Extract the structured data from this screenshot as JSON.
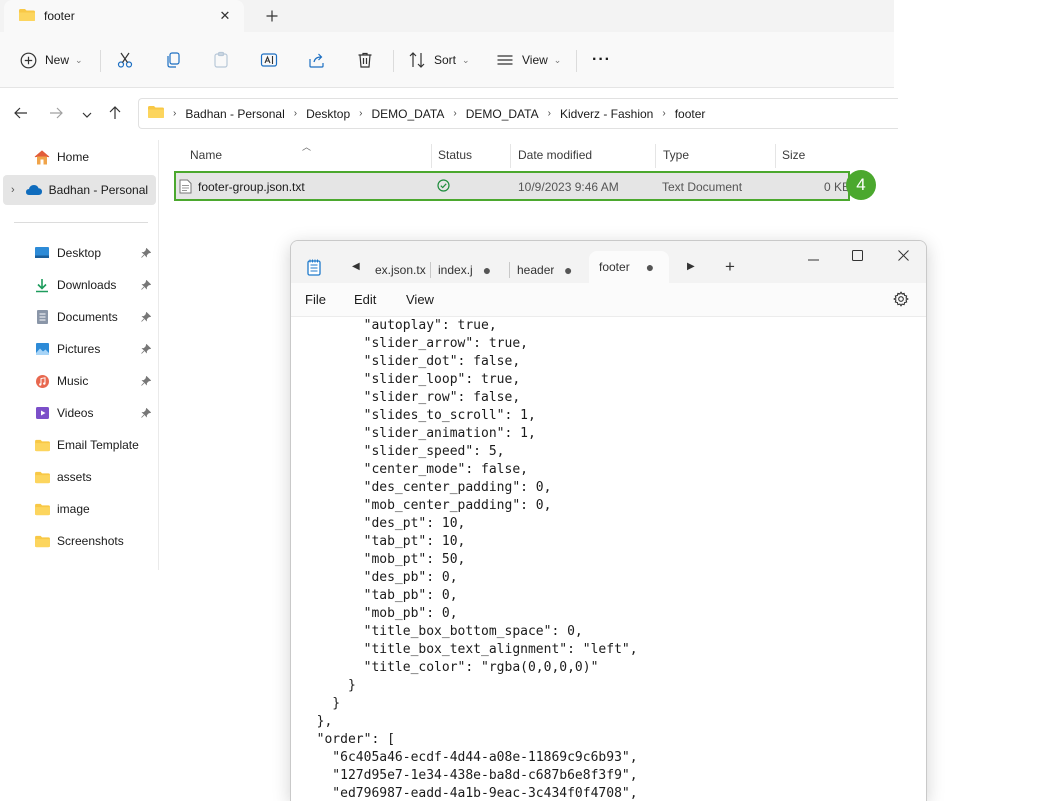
{
  "explorer": {
    "tab_title": "footer",
    "toolbar": {
      "new_label": "New",
      "sort_label": "Sort",
      "view_label": "View",
      "more_label": "···"
    },
    "breadcrumb": [
      "Badhan - Personal",
      "Desktop",
      "DEMO_DATA",
      "DEMO_DATA",
      "Kidverz - Fashion",
      "footer"
    ],
    "sidebar": {
      "home": "Home",
      "cloud": "Badhan - Personal",
      "pinned": [
        {
          "label": "Desktop",
          "icon": "desktop-icon"
        },
        {
          "label": "Downloads",
          "icon": "downloads-icon"
        },
        {
          "label": "Documents",
          "icon": "documents-icon"
        },
        {
          "label": "Pictures",
          "icon": "pictures-icon"
        },
        {
          "label": "Music",
          "icon": "music-icon"
        },
        {
          "label": "Videos",
          "icon": "videos-icon"
        }
      ],
      "folders": [
        "Email Template",
        "assets",
        "image",
        "Screenshots"
      ]
    },
    "columns": {
      "name": "Name",
      "status": "Status",
      "date": "Date modified",
      "type": "Type",
      "size": "Size"
    },
    "file": {
      "name": "footer-group.json.txt",
      "date": "10/9/2023 9:46 AM",
      "type": "Text Document",
      "size": "0 KB"
    },
    "badge": "4"
  },
  "notepad": {
    "tabs": [
      "ex.json.tx",
      "index.j",
      "header",
      "footer"
    ],
    "menu": {
      "file": "File",
      "edit": "Edit",
      "view": "View"
    },
    "lines": [
      "        \"autoplay\": true,",
      "        \"slider_arrow\": true,",
      "        \"slider_dot\": false,",
      "        \"slider_loop\": true,",
      "        \"slider_row\": false,",
      "        \"slides_to_scroll\": 1,",
      "        \"slider_animation\": 1,",
      "        \"slider_speed\": 5,",
      "        \"center_mode\": false,",
      "        \"des_center_padding\": 0,",
      "        \"mob_center_padding\": 0,",
      "        \"des_pt\": 10,",
      "        \"tab_pt\": 10,",
      "        \"mob_pt\": 50,",
      "        \"des_pb\": 0,",
      "        \"tab_pb\": 0,",
      "        \"mob_pb\": 0,",
      "        \"title_box_bottom_space\": 0,",
      "        \"title_box_text_alignment\": \"left\",",
      "        \"title_color\": \"rgba(0,0,0,0)\"",
      "      }",
      "    }",
      "  },",
      "  \"order\": [",
      "    \"6c405a46-ecdf-4d44-a08e-11869c9c6b93\",",
      "    \"127d95e7-1e34-438e-ba8d-c687b6e8f3f9\",",
      "    \"ed796987-eadd-4a1b-9eac-3c434f0f4708\","
    ]
  },
  "colors": {
    "selection_border": "#4ba82e",
    "folder": "#f8c846",
    "accent": "#0067c0"
  }
}
